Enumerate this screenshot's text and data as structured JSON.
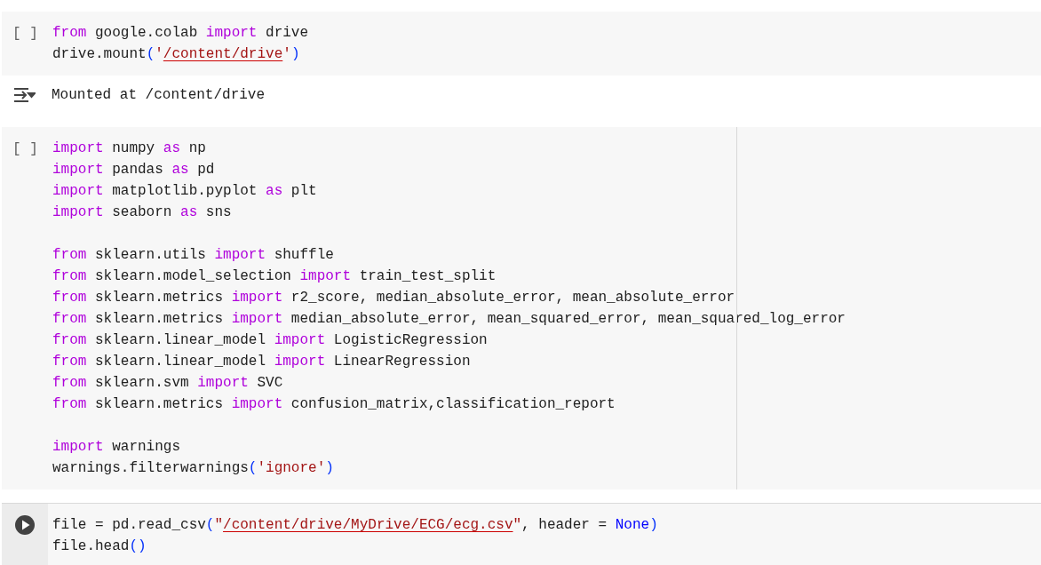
{
  "cells": [
    {
      "kind": "code",
      "gutter": "[ ]",
      "ruler": false,
      "groups": [
        [
          [
            {
              "kind": "kw",
              "t": "from"
            },
            {
              "kind": "text",
              "t": " google.colab "
            },
            {
              "kind": "kw",
              "t": "import"
            },
            {
              "kind": "text",
              "t": " drive"
            }
          ],
          [
            {
              "kind": "text",
              "t": "drive.mount"
            },
            {
              "kind": "paren",
              "t": "("
            },
            {
              "kind": "str",
              "t": "'"
            },
            {
              "kind": "flagged",
              "t": "/content/drive"
            },
            {
              "kind": "str",
              "t": "'"
            },
            {
              "kind": "paren",
              "t": ")"
            }
          ]
        ]
      ]
    },
    {
      "kind": "output",
      "text": "Mounted at /content/drive"
    },
    {
      "kind": "code",
      "gutter": "[ ]",
      "ruler": true,
      "groups": [
        [
          [
            {
              "kind": "kw",
              "t": "import"
            },
            {
              "kind": "text",
              "t": " numpy "
            },
            {
              "kind": "kw",
              "t": "as"
            },
            {
              "kind": "text",
              "t": " np"
            }
          ],
          [
            {
              "kind": "kw",
              "t": "import"
            },
            {
              "kind": "text",
              "t": " pandas "
            },
            {
              "kind": "kw",
              "t": "as"
            },
            {
              "kind": "text",
              "t": " pd"
            }
          ],
          [
            {
              "kind": "kw",
              "t": "import"
            },
            {
              "kind": "text",
              "t": " matplotlib.pyplot "
            },
            {
              "kind": "kw",
              "t": "as"
            },
            {
              "kind": "text",
              "t": " plt"
            }
          ],
          [
            {
              "kind": "kw",
              "t": "import"
            },
            {
              "kind": "text",
              "t": " seaborn "
            },
            {
              "kind": "kw",
              "t": "as"
            },
            {
              "kind": "text",
              "t": " sns"
            }
          ]
        ],
        [
          [
            {
              "kind": "kw",
              "t": "from"
            },
            {
              "kind": "text",
              "t": " sklearn.utils "
            },
            {
              "kind": "kw",
              "t": "import"
            },
            {
              "kind": "text",
              "t": " shuffle"
            }
          ],
          [
            {
              "kind": "kw",
              "t": "from"
            },
            {
              "kind": "text",
              "t": " sklearn.model_selection "
            },
            {
              "kind": "kw",
              "t": "import"
            },
            {
              "kind": "text",
              "t": " train_test_split"
            }
          ],
          [
            {
              "kind": "kw",
              "t": "from"
            },
            {
              "kind": "text",
              "t": " sklearn.metrics "
            },
            {
              "kind": "kw",
              "t": "import"
            },
            {
              "kind": "text",
              "t": " r2_score, median_absolute_error, mean_absolute_error"
            }
          ],
          [
            {
              "kind": "kw",
              "t": "from"
            },
            {
              "kind": "text",
              "t": " sklearn.metrics "
            },
            {
              "kind": "kw",
              "t": "import"
            },
            {
              "kind": "text",
              "t": " median_absolute_error, mean_squared_error, mean_squared_log_error"
            }
          ],
          [
            {
              "kind": "kw",
              "t": "from"
            },
            {
              "kind": "text",
              "t": " sklearn.linear_model "
            },
            {
              "kind": "kw",
              "t": "import"
            },
            {
              "kind": "text",
              "t": " LogisticRegression"
            }
          ],
          [
            {
              "kind": "kw",
              "t": "from"
            },
            {
              "kind": "text",
              "t": " sklearn.linear_model "
            },
            {
              "kind": "kw",
              "t": "import"
            },
            {
              "kind": "text",
              "t": " LinearRegression"
            }
          ],
          [
            {
              "kind": "kw",
              "t": "from"
            },
            {
              "kind": "text",
              "t": " sklearn.svm "
            },
            {
              "kind": "kw",
              "t": "import"
            },
            {
              "kind": "text",
              "t": " SVC"
            }
          ],
          [
            {
              "kind": "kw",
              "t": "from"
            },
            {
              "kind": "text",
              "t": " sklearn.metrics "
            },
            {
              "kind": "kw",
              "t": "import"
            },
            {
              "kind": "text",
              "t": " confusion_matrix,classification_report"
            }
          ]
        ],
        [
          [
            {
              "kind": "kw",
              "t": "import"
            },
            {
              "kind": "text",
              "t": " warnings"
            }
          ],
          [
            {
              "kind": "text",
              "t": "warnings.filterwarnings"
            },
            {
              "kind": "paren",
              "t": "("
            },
            {
              "kind": "str",
              "t": "'ignore'"
            },
            {
              "kind": "paren",
              "t": ")"
            }
          ]
        ]
      ]
    },
    {
      "kind": "code_hover",
      "ruler": false,
      "groups": [
        [
          [
            {
              "kind": "text",
              "t": "file = pd.read_csv"
            },
            {
              "kind": "paren",
              "t": "("
            },
            {
              "kind": "str",
              "t": "\""
            },
            {
              "kind": "flagged",
              "t": "/content/drive/MyDrive/ECG/ecg.csv"
            },
            {
              "kind": "str",
              "t": "\""
            },
            {
              "kind": "text",
              "t": ", header = "
            },
            {
              "kind": "const",
              "t": "None"
            },
            {
              "kind": "paren",
              "t": ")"
            }
          ],
          [
            {
              "kind": "text",
              "t": "file.head"
            },
            {
              "kind": "paren",
              "t": "()"
            }
          ]
        ]
      ]
    }
  ]
}
